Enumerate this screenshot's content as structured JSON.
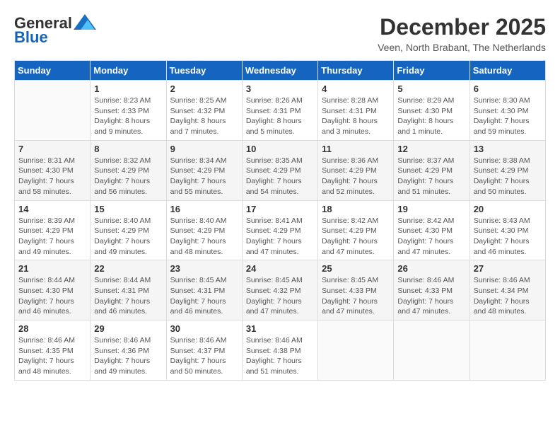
{
  "header": {
    "logo_line1": "General",
    "logo_line2": "Blue",
    "month_year": "December 2025",
    "location": "Veen, North Brabant, The Netherlands"
  },
  "weekdays": [
    "Sunday",
    "Monday",
    "Tuesday",
    "Wednesday",
    "Thursday",
    "Friday",
    "Saturday"
  ],
  "weeks": [
    [
      {
        "day": "",
        "info": ""
      },
      {
        "day": "1",
        "info": "Sunrise: 8:23 AM\nSunset: 4:33 PM\nDaylight: 8 hours\nand 9 minutes."
      },
      {
        "day": "2",
        "info": "Sunrise: 8:25 AM\nSunset: 4:32 PM\nDaylight: 8 hours\nand 7 minutes."
      },
      {
        "day": "3",
        "info": "Sunrise: 8:26 AM\nSunset: 4:31 PM\nDaylight: 8 hours\nand 5 minutes."
      },
      {
        "day": "4",
        "info": "Sunrise: 8:28 AM\nSunset: 4:31 PM\nDaylight: 8 hours\nand 3 minutes."
      },
      {
        "day": "5",
        "info": "Sunrise: 8:29 AM\nSunset: 4:30 PM\nDaylight: 8 hours\nand 1 minute."
      },
      {
        "day": "6",
        "info": "Sunrise: 8:30 AM\nSunset: 4:30 PM\nDaylight: 7 hours\nand 59 minutes."
      }
    ],
    [
      {
        "day": "7",
        "info": "Sunrise: 8:31 AM\nSunset: 4:30 PM\nDaylight: 7 hours\nand 58 minutes."
      },
      {
        "day": "8",
        "info": "Sunrise: 8:32 AM\nSunset: 4:29 PM\nDaylight: 7 hours\nand 56 minutes."
      },
      {
        "day": "9",
        "info": "Sunrise: 8:34 AM\nSunset: 4:29 PM\nDaylight: 7 hours\nand 55 minutes."
      },
      {
        "day": "10",
        "info": "Sunrise: 8:35 AM\nSunset: 4:29 PM\nDaylight: 7 hours\nand 54 minutes."
      },
      {
        "day": "11",
        "info": "Sunrise: 8:36 AM\nSunset: 4:29 PM\nDaylight: 7 hours\nand 52 minutes."
      },
      {
        "day": "12",
        "info": "Sunrise: 8:37 AM\nSunset: 4:29 PM\nDaylight: 7 hours\nand 51 minutes."
      },
      {
        "day": "13",
        "info": "Sunrise: 8:38 AM\nSunset: 4:29 PM\nDaylight: 7 hours\nand 50 minutes."
      }
    ],
    [
      {
        "day": "14",
        "info": "Sunrise: 8:39 AM\nSunset: 4:29 PM\nDaylight: 7 hours\nand 49 minutes."
      },
      {
        "day": "15",
        "info": "Sunrise: 8:40 AM\nSunset: 4:29 PM\nDaylight: 7 hours\nand 49 minutes."
      },
      {
        "day": "16",
        "info": "Sunrise: 8:40 AM\nSunset: 4:29 PM\nDaylight: 7 hours\nand 48 minutes."
      },
      {
        "day": "17",
        "info": "Sunrise: 8:41 AM\nSunset: 4:29 PM\nDaylight: 7 hours\nand 47 minutes."
      },
      {
        "day": "18",
        "info": "Sunrise: 8:42 AM\nSunset: 4:29 PM\nDaylight: 7 hours\nand 47 minutes."
      },
      {
        "day": "19",
        "info": "Sunrise: 8:42 AM\nSunset: 4:30 PM\nDaylight: 7 hours\nand 47 minutes."
      },
      {
        "day": "20",
        "info": "Sunrise: 8:43 AM\nSunset: 4:30 PM\nDaylight: 7 hours\nand 46 minutes."
      }
    ],
    [
      {
        "day": "21",
        "info": "Sunrise: 8:44 AM\nSunset: 4:30 PM\nDaylight: 7 hours\nand 46 minutes."
      },
      {
        "day": "22",
        "info": "Sunrise: 8:44 AM\nSunset: 4:31 PM\nDaylight: 7 hours\nand 46 minutes."
      },
      {
        "day": "23",
        "info": "Sunrise: 8:45 AM\nSunset: 4:31 PM\nDaylight: 7 hours\nand 46 minutes."
      },
      {
        "day": "24",
        "info": "Sunrise: 8:45 AM\nSunset: 4:32 PM\nDaylight: 7 hours\nand 47 minutes."
      },
      {
        "day": "25",
        "info": "Sunrise: 8:45 AM\nSunset: 4:33 PM\nDaylight: 7 hours\nand 47 minutes."
      },
      {
        "day": "26",
        "info": "Sunrise: 8:46 AM\nSunset: 4:33 PM\nDaylight: 7 hours\nand 47 minutes."
      },
      {
        "day": "27",
        "info": "Sunrise: 8:46 AM\nSunset: 4:34 PM\nDaylight: 7 hours\nand 48 minutes."
      }
    ],
    [
      {
        "day": "28",
        "info": "Sunrise: 8:46 AM\nSunset: 4:35 PM\nDaylight: 7 hours\nand 48 minutes."
      },
      {
        "day": "29",
        "info": "Sunrise: 8:46 AM\nSunset: 4:36 PM\nDaylight: 7 hours\nand 49 minutes."
      },
      {
        "day": "30",
        "info": "Sunrise: 8:46 AM\nSunset: 4:37 PM\nDaylight: 7 hours\nand 50 minutes."
      },
      {
        "day": "31",
        "info": "Sunrise: 8:46 AM\nSunset: 4:38 PM\nDaylight: 7 hours\nand 51 minutes."
      },
      {
        "day": "",
        "info": ""
      },
      {
        "day": "",
        "info": ""
      },
      {
        "day": "",
        "info": ""
      }
    ]
  ]
}
